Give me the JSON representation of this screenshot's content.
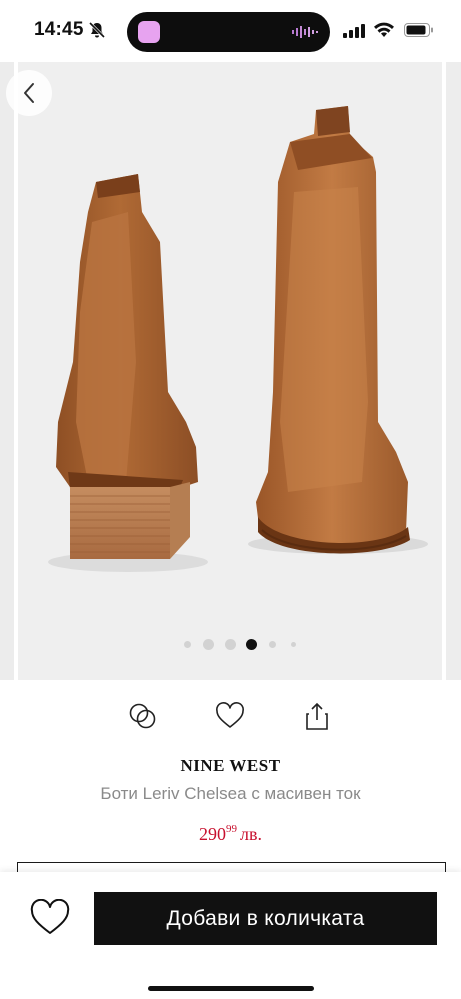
{
  "status_bar": {
    "time": "14:45"
  },
  "product": {
    "brand": "NINE WEST",
    "name": "Боти Leriv Chelsea с масивен ток",
    "price_main": "290",
    "price_cents": "99",
    "currency": "лв."
  },
  "gallery": {
    "total_images": 6,
    "active_index": 3
  },
  "bottom_bar": {
    "add_to_cart_label": "Добави в количката"
  },
  "icons": {
    "back": "chevron-left-icon",
    "compare": "compare-circles-icon",
    "favorite": "heart-icon",
    "share": "share-icon"
  },
  "colors": {
    "price": "#c8102e",
    "button": "#111111",
    "boot_leather": "#b5703d"
  }
}
